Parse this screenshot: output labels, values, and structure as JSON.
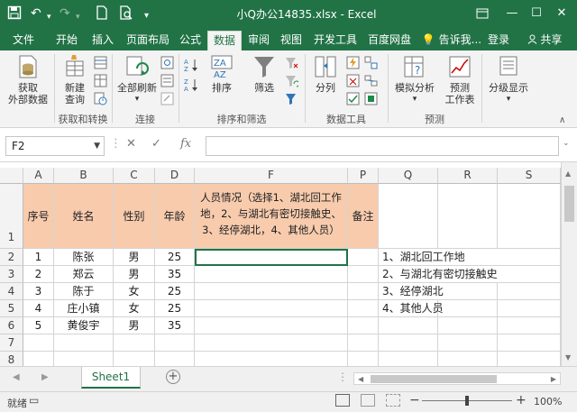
{
  "window": {
    "title": "小Q办公14835.xlsx - Excel"
  },
  "tabs": [
    {
      "label": "文件",
      "active": false
    },
    {
      "label": "开始",
      "active": false
    },
    {
      "label": "插入",
      "active": false
    },
    {
      "label": "页面布局",
      "active": false
    },
    {
      "label": "公式",
      "active": false
    },
    {
      "label": "数据",
      "active": true
    },
    {
      "label": "审阅",
      "active": false
    },
    {
      "label": "视图",
      "active": false
    },
    {
      "label": "开发工具",
      "active": false
    },
    {
      "label": "百度网盘",
      "active": false
    }
  ],
  "tell_me": "告诉我...",
  "login": "登录",
  "share": "共享",
  "ribbon": {
    "get_external_data": "获取\n外部数据",
    "new_query": "新建\n查询",
    "refresh_all": "全部刷新",
    "sort": "排序",
    "filter": "筛选",
    "text_to_columns": "分列",
    "what_if": "模拟分析",
    "forecast": "预测\n工作表",
    "outline": "分级显示",
    "groups": {
      "get_transform": "获取和转换",
      "connections": "连接",
      "sort_filter": "排序和筛选",
      "data_tools": "数据工具",
      "forecast": "预测"
    }
  },
  "formula_bar": {
    "name_box": "F2",
    "formula": ""
  },
  "columns": [
    "A",
    "B",
    "C",
    "D",
    "F",
    "P",
    "Q",
    "R",
    "S"
  ],
  "row_numbers": [
    "1",
    "2",
    "3",
    "4",
    "5",
    "6",
    "7",
    "8"
  ],
  "header_row": {
    "A": "序号",
    "B": "姓名",
    "C": "性别",
    "D": "年龄",
    "F": "人员情况（选择1、湖北回工作地，2、与湖北有密切接触史、3、经停湖北，4、其他人员）",
    "P": "备注"
  },
  "rows": [
    {
      "A": "1",
      "B": "陈张",
      "C": "男",
      "D": "25"
    },
    {
      "A": "2",
      "B": "郑云",
      "C": "男",
      "D": "35"
    },
    {
      "A": "3",
      "B": "陈于",
      "C": "女",
      "D": "25"
    },
    {
      "A": "4",
      "B": "庄小镇",
      "C": "女",
      "D": "25"
    },
    {
      "A": "5",
      "B": "黄俊宇",
      "C": "男",
      "D": "35"
    }
  ],
  "options_list": [
    "1、湖北回工作地",
    "2、与湖北有密切接触史",
    "3、经停湖北",
    "4、其他人员"
  ],
  "sheets": [
    {
      "label": "Sheet1",
      "active": true
    }
  ],
  "status": {
    "mode": "就绪",
    "zoom": "100%"
  },
  "colors": {
    "accent": "#217346",
    "header_fill": "#f8cbad"
  }
}
